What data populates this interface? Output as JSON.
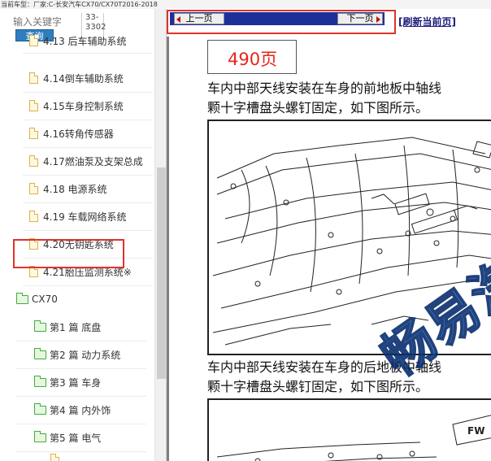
{
  "topbar": {
    "text": "当前车型：厂家:C-长安汽车CX70/CX70T2016-2018"
  },
  "search": {
    "placeholder": "输入关键字",
    "button_label": "查询",
    "page_range_line1": "33-",
    "page_range_line2": "3302"
  },
  "tree": {
    "items": [
      {
        "label": "4.13 后车辅助系统",
        "type": "file"
      },
      {
        "label": "4.14倒车辅助系统",
        "type": "file"
      },
      {
        "label": "4.15车身控制系统",
        "type": "file"
      },
      {
        "label": "4.16转角传感器",
        "type": "file"
      },
      {
        "label": "4.17燃油泵及支架总成",
        "type": "file"
      },
      {
        "label": "4.18 电源系统",
        "type": "file"
      },
      {
        "label": "4.19 车载网络系统",
        "type": "file"
      },
      {
        "label": "4.20无钥匙系统",
        "type": "file"
      },
      {
        "label": "4.21胎压监测系统※",
        "type": "file"
      },
      {
        "label": "CX70",
        "type": "folder"
      },
      {
        "label": "第1 篇 底盘",
        "type": "folder"
      },
      {
        "label": "第2 篇 动力系统",
        "type": "folder"
      },
      {
        "label": "第3 篇 车身",
        "type": "folder"
      },
      {
        "label": "第4 篇 内外饰",
        "type": "folder"
      },
      {
        "label": "第5 篇 电气",
        "type": "folder"
      }
    ]
  },
  "nav": {
    "prev_label": "上一页",
    "next_label": "下一页",
    "refresh_label": "[刷新当前页]"
  },
  "document": {
    "page_number": "490页",
    "para1_line1": "车内中部天线安装在车身的前地板中轴线",
    "para1_line2": "颗十字槽盘头螺钉固定，如下图所示。",
    "para2_line1": "车内中部天线安装在车身的后地板中轴线",
    "para2_line2": "颗十字槽盘头螺钉固定，如下图所示。",
    "watermark": "畅易汽",
    "fw_label": "FW"
  }
}
